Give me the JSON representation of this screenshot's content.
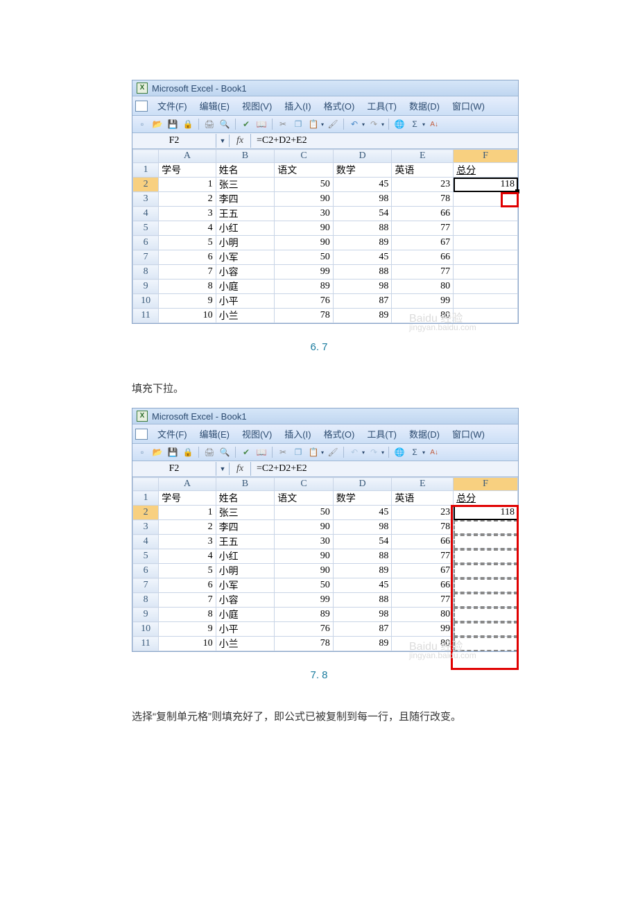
{
  "title": "Microsoft Excel - Book1",
  "menus": [
    "文件(F)",
    "编辑(E)",
    "视图(V)",
    "插入(I)",
    "格式(O)",
    "工具(T)",
    "数据(D)",
    "窗口(W)"
  ],
  "formula_bar": {
    "cell_ref": "F2",
    "fx": "fx",
    "formula": "=C2+D2+E2"
  },
  "columns": [
    "A",
    "B",
    "C",
    "D",
    "E",
    "F"
  ],
  "headers": {
    "A": "学号",
    "B": "姓名",
    "C": "语文",
    "D": "数学",
    "E": "英语",
    "F": "总分"
  },
  "rows": [
    {
      "n": 1,
      "A": "1",
      "B": "张三",
      "C": "50",
      "D": "45",
      "E": "23"
    },
    {
      "n": 2,
      "A": "2",
      "B": "李四",
      "C": "90",
      "D": "98",
      "E": "78"
    },
    {
      "n": 3,
      "A": "3",
      "B": "王五",
      "C": "30",
      "D": "54",
      "E": "66"
    },
    {
      "n": 4,
      "A": "4",
      "B": "小红",
      "C": "90",
      "D": "88",
      "E": "77"
    },
    {
      "n": 5,
      "A": "5",
      "B": "小明",
      "C": "90",
      "D": "89",
      "E": "67"
    },
    {
      "n": 6,
      "A": "6",
      "B": "小军",
      "C": "50",
      "D": "45",
      "E": "66"
    },
    {
      "n": 7,
      "A": "7",
      "B": "小容",
      "C": "99",
      "D": "88",
      "E": "77"
    },
    {
      "n": 8,
      "A": "8",
      "B": "小庭",
      "C": "89",
      "D": "98",
      "E": "80"
    },
    {
      "n": 9,
      "A": "9",
      "B": "小平",
      "C": "76",
      "D": "87",
      "E": "99"
    },
    {
      "n": 10,
      "A": "10",
      "B": "小兰",
      "C": "78",
      "D": "89",
      "E": "80"
    }
  ],
  "shot1": {
    "F2_value": "118",
    "caption": "6. 7"
  },
  "shot2": {
    "F2_value": "118",
    "caption": "7. 8",
    "instruction_before": "填充下拉。"
  },
  "instruction_after": "选择“复制单元格”则填充好了，即公式已被复制到每一行，且随行改变。",
  "watermark": {
    "logo": "Baidu 经验",
    "sub": "jingyan.baidu.com"
  }
}
